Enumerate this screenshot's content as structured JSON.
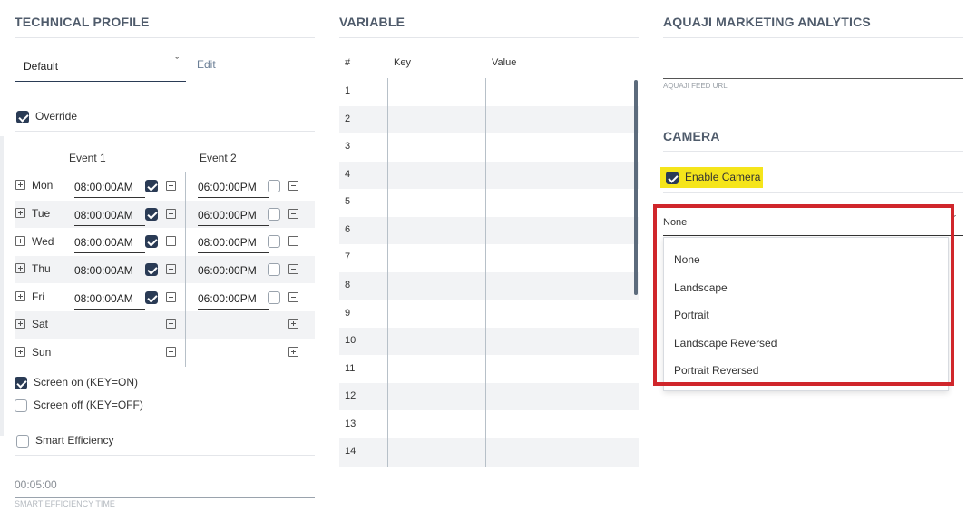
{
  "technical_profile": {
    "title": "TECHNICAL PROFILE",
    "profile_select": "Default",
    "edit_label": "Edit",
    "override_label": "Override",
    "override_checked": true,
    "event1_header": "Event 1",
    "event2_header": "Event 2",
    "schedule": [
      {
        "day": "Mon",
        "e1": "08:00:00AM",
        "e1_checked": true,
        "e2": "06:00:00PM",
        "e2_checked": false
      },
      {
        "day": "Tue",
        "e1": "08:00:00AM",
        "e1_checked": true,
        "e2": "06:00:00PM",
        "e2_checked": false
      },
      {
        "day": "Wed",
        "e1": "08:00:00AM",
        "e1_checked": true,
        "e2": "08:00:00PM",
        "e2_checked": false
      },
      {
        "day": "Thu",
        "e1": "08:00:00AM",
        "e1_checked": true,
        "e2": "06:00:00PM",
        "e2_checked": false
      },
      {
        "day": "Fri",
        "e1": "08:00:00AM",
        "e1_checked": true,
        "e2": "06:00:00PM",
        "e2_checked": false
      },
      {
        "day": "Sat"
      },
      {
        "day": "Sun"
      }
    ],
    "screen_on_label": "Screen on (KEY=ON)",
    "screen_on_checked": true,
    "screen_off_label": "Screen off (KEY=OFF)",
    "screen_off_checked": false,
    "smart_efficiency_label": "Smart Efficiency",
    "smart_efficiency_checked": false,
    "smart_efficiency_time_value": "00:05:00",
    "smart_efficiency_time_label": "SMART EFFICIENCY TIME"
  },
  "variable": {
    "title": "VARIABLE",
    "columns": [
      "#",
      "Key",
      "Value"
    ],
    "rows": [
      "1",
      "2",
      "3",
      "4",
      "5",
      "6",
      "7",
      "8",
      "9",
      "10",
      "11",
      "12",
      "13",
      "14"
    ]
  },
  "aquaji": {
    "title": "AQUAJI MARKETING ANALYTICS",
    "feed_url_label": "AQUAJI FEED URL",
    "feed_url_value": ""
  },
  "camera": {
    "title": "CAMERA",
    "enable_label": "Enable Camera",
    "enable_checked": true,
    "orientation_value": "None",
    "options": [
      "None",
      "Landscape",
      "Portrait",
      "Landscape Reversed",
      "Portrait Reversed"
    ],
    "highlight_color": "#f5e51b",
    "annotation_color": "#d0262b"
  }
}
